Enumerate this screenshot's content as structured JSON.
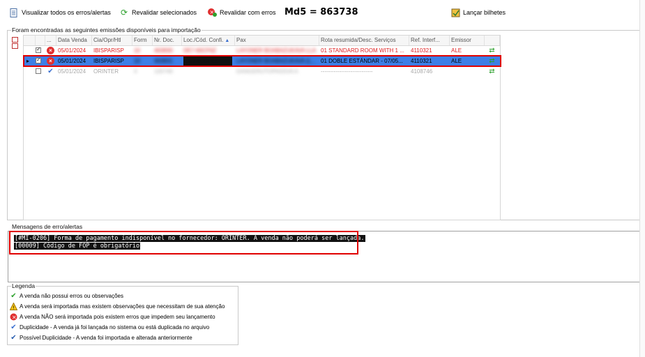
{
  "toolbar": {
    "view_all": "Visualizar todos os erros/alertas",
    "revalidate_selected": "Revalidar selecionados",
    "revalidate_errors": "Revalidar com erros",
    "md5": "Md5 = 863738",
    "launch_tickets": "Lançar bilhetes"
  },
  "emissions": {
    "title": "Foram encontradas as seguintes emissões disponíveis para importação",
    "columns": [
      "...",
      "Data Venda",
      "Cia/Opr/Htl",
      "Form",
      "Nr. Doc.",
      "Loc./Cód. Confi.",
      "Pax",
      "Rota resumida/Desc. Serviços",
      "Ref. Interf...",
      "Emissor"
    ],
    "rows": [
      {
        "data_venda": "05/01/2024",
        "cia": "IBISPARISP",
        "form": "10",
        "nr_doc": "463830",
        "loc": "DE7-60CF6Z",
        "pax": "LAYONER BOABAZUKAVA LLA",
        "rota": "01 STANDARD ROOM WITH 1 ...",
        "ref": "4110321",
        "emissor": "ALE"
      },
      {
        "data_venda": "05/01/2024",
        "cia": "IBISPARISP",
        "form": "10",
        "nr_doc": "463831",
        "loc": "DE7-60CF6Z",
        "pax": "LAYONER BOABAZUKAVA (L...",
        "rota": "01 DOBLE ESTÁNDAR  - 07/05...",
        "ref": "4110321",
        "emissor": "ALE"
      },
      {
        "data_venda": "05/01/2024",
        "cia": "ORINTER",
        "form": "4",
        "nr_doc": "100746",
        "loc": "",
        "pax": "DANGERUTOPASSVA A",
        "rota": "----------------------------",
        "ref": "4108746",
        "emissor": ""
      }
    ]
  },
  "messages": {
    "title": "Mensagens de erro/alertas",
    "lines": [
      "[#MI-0206] Forma de pagamento indisponível no fornecedor: ORINTER. A venda não poderá ser lançada.",
      "[00009] Código de FOP é obrigatório"
    ]
  },
  "legend": {
    "title": "Legenda",
    "items": [
      {
        "icon": "check-icon",
        "text": "A venda não possui erros ou observações"
      },
      {
        "icon": "warning-icon",
        "text": "A venda será importada mas existem observações que necessitam de sua atenção"
      },
      {
        "icon": "error-icon",
        "text": "A venda NÃO será importada pois existem erros que impedem seu lançamento"
      },
      {
        "icon": "duplicate-icon",
        "text": "Duplicidade - A venda já foi lançada no sistema ou está duplicada no arquivo"
      },
      {
        "icon": "possible-duplicate-icon",
        "text": "Possível Duplicidade - A venda foi importada e alterada anteriormente"
      }
    ]
  },
  "colors": {
    "error_text": "#e02020",
    "selection": "#3d7fe6",
    "highlight_box": "#e00000"
  }
}
